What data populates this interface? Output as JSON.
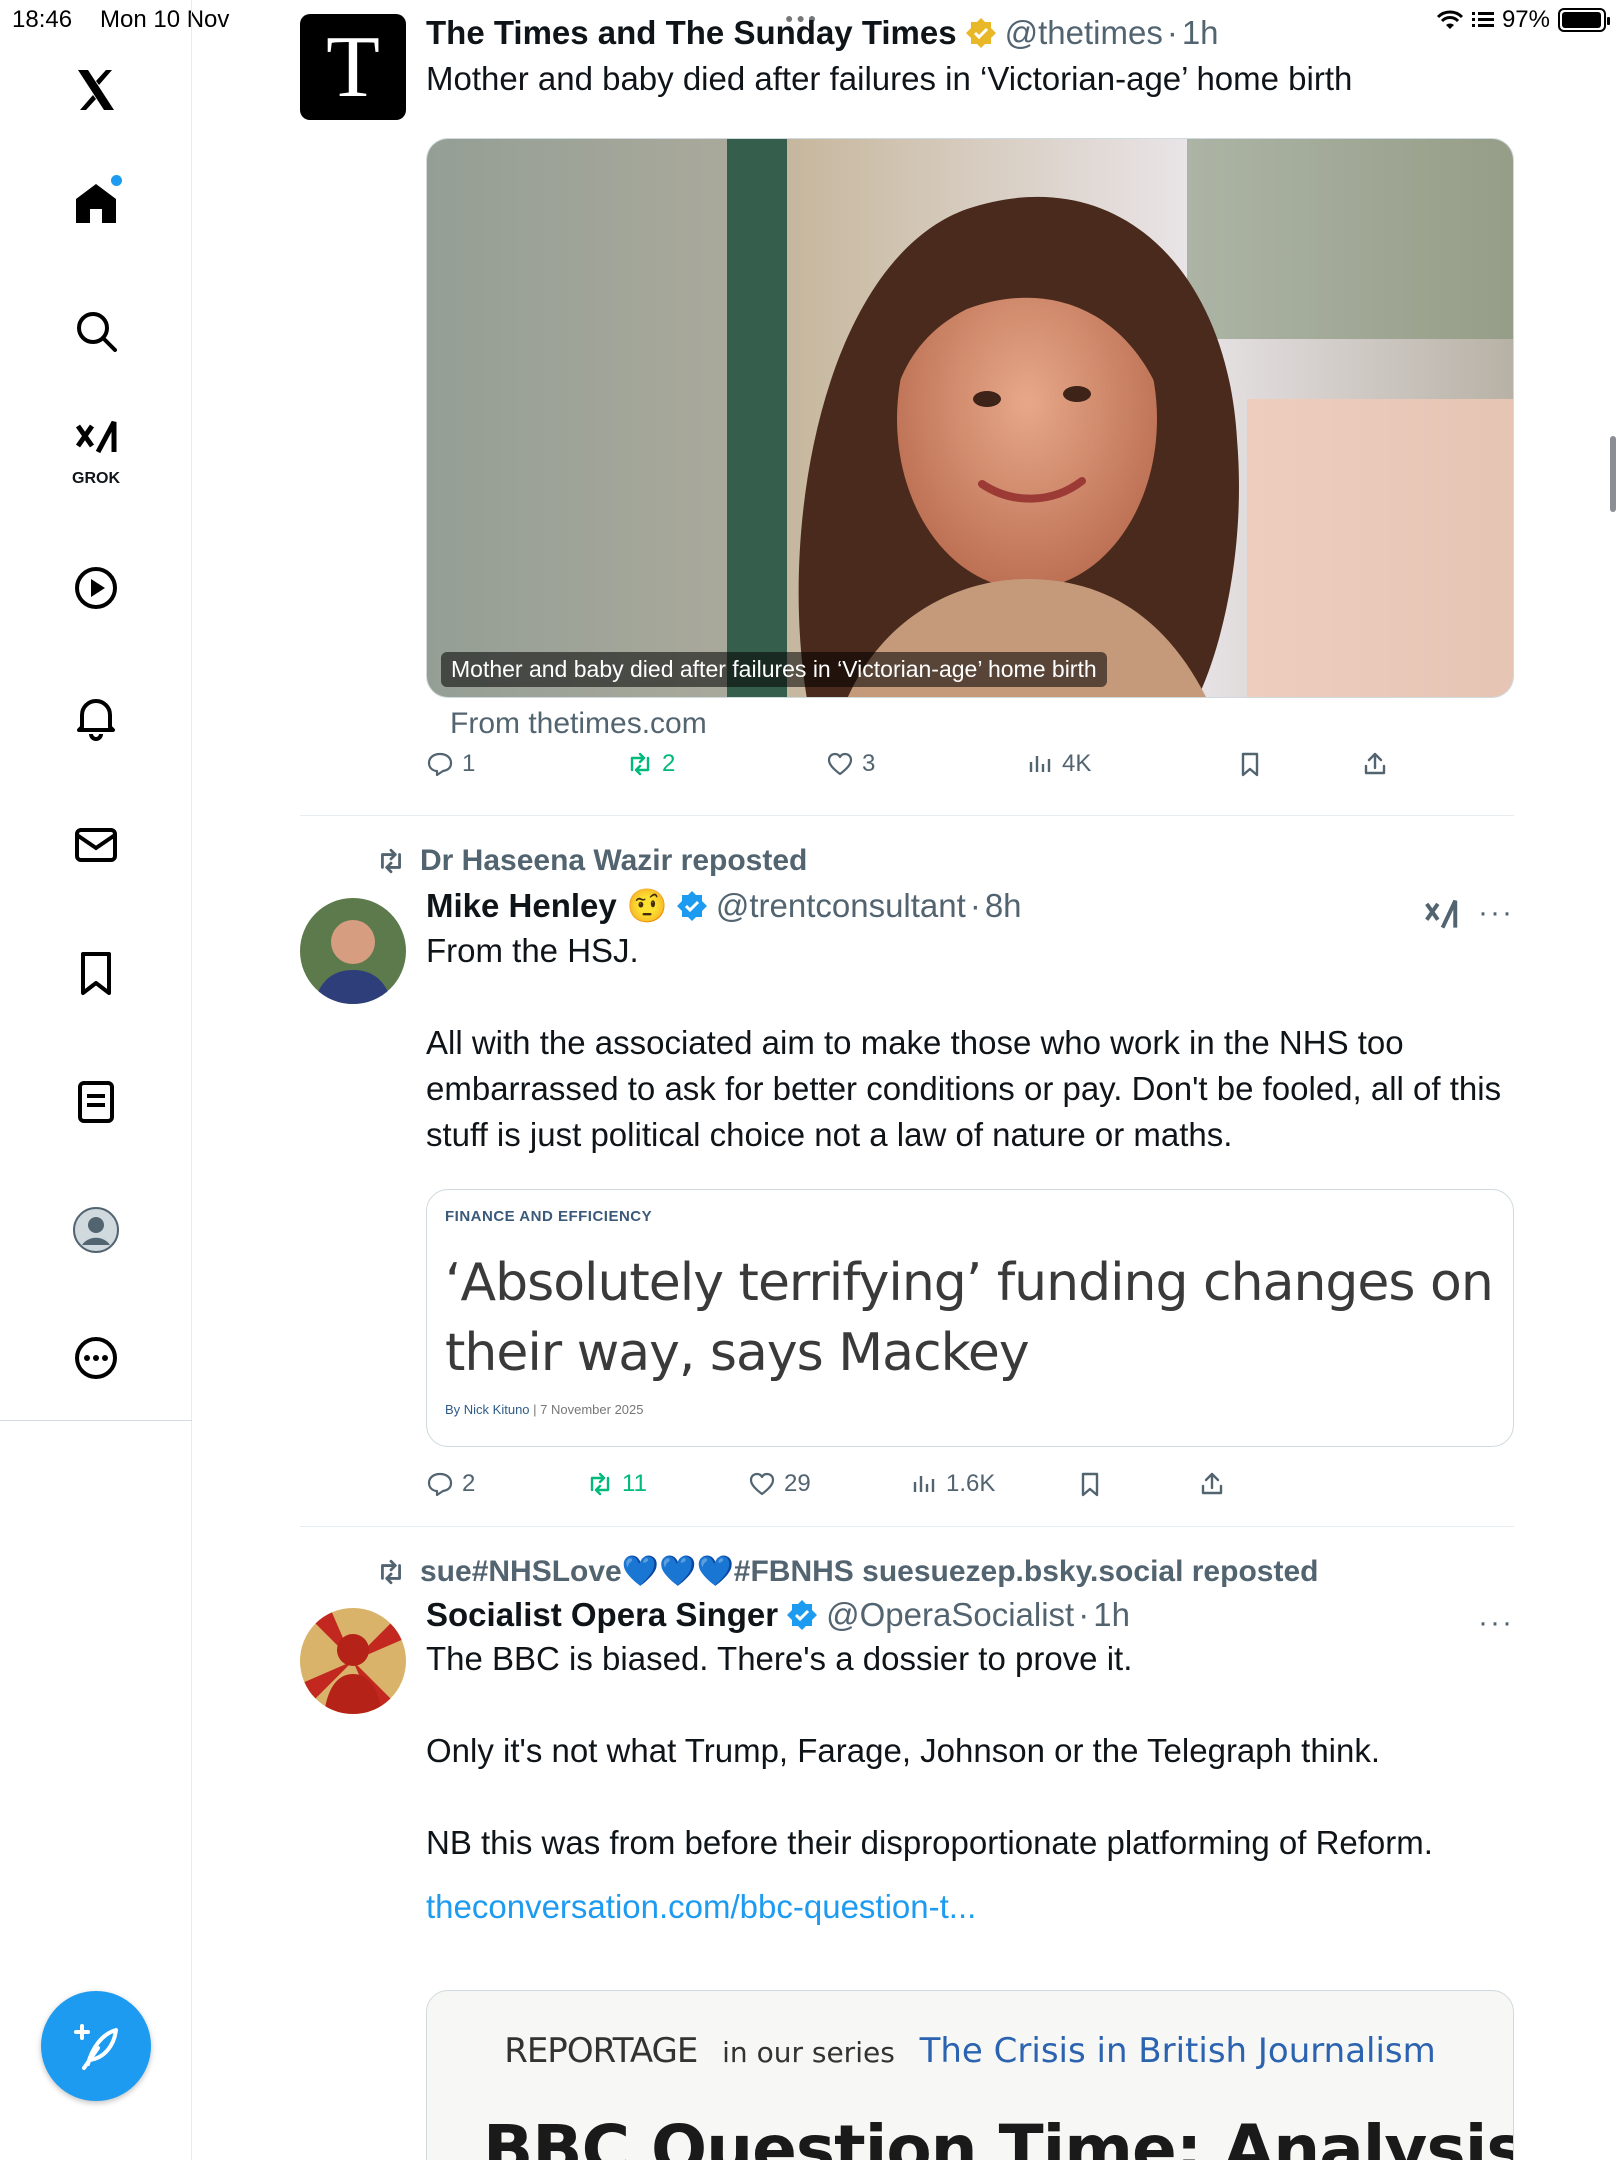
{
  "status_bar": {
    "time": "18:46",
    "date": "Mon 10 Nov",
    "battery": "97%",
    "battery_level": 0.97
  },
  "sidebar": {
    "items": [
      {
        "icon": "x-logo-icon",
        "label": "X"
      },
      {
        "icon": "home-icon",
        "label": "Home"
      },
      {
        "icon": "search-icon",
        "label": "Explore"
      },
      {
        "icon": "grok-icon",
        "label": "GROK"
      },
      {
        "icon": "play-icon",
        "label": "Video"
      },
      {
        "icon": "bell-icon",
        "label": "Notifications"
      },
      {
        "icon": "mail-icon",
        "label": "Messages"
      },
      {
        "icon": "bookmark-icon",
        "label": "Bookmarks"
      },
      {
        "icon": "list-icon",
        "label": "Lists"
      },
      {
        "icon": "profile-icon",
        "label": "Profile"
      },
      {
        "icon": "more-icon",
        "label": "More"
      }
    ],
    "grok_label": "GROK"
  },
  "posts": [
    {
      "avatar_letter": "T",
      "name": "The Times and The Sunday Times",
      "handle": "@thetimes",
      "time": "1h",
      "text": "Mother and baby died after failures in ‘Victorian-age’ home birth",
      "media_caption": "Mother and baby died after failures in ‘Victorian-age’ home birth",
      "source": "From thetimes.com",
      "stats": {
        "replies": "1",
        "reposts": "2",
        "likes": "3",
        "views": "4K"
      }
    },
    {
      "reposted_by": "Dr Haseena Wazir reposted",
      "name": "Mike Henley",
      "emoji": "🤨",
      "handle": "@trentconsultant",
      "time": "8h",
      "text": "From the HSJ.\n\nAll with the associated aim to make those who work in the NHS too embarrassed to ask for better conditions or pay. Don't be fooled, all of this stuff is just political choice not a law of nature or maths.",
      "card": {
        "kicker": "FINANCE AND EFFICIENCY",
        "headline": "‘Absolutely terrifying’ funding changes on their way, says Mackey",
        "byline_prefix": "By Nick Kituno",
        "byline_date": "| 7 November 2025"
      },
      "stats": {
        "replies": "2",
        "reposts": "11",
        "likes": "29",
        "views": "1.6K"
      }
    },
    {
      "reposted_by": "sue#NHSLove💙💙💙#FBNHS suesuezep.bsky.social reposted",
      "name": "Socialist Opera Singer",
      "handle": "@OperaSocialist",
      "time": "1h",
      "text": "The BBC is biased. There's a dossier to prove it.\n\nOnly it's not what Trump, Farage, Johnson or the Telegraph think.\n\nNB this was from before their disproportionate platforming of Reform.",
      "link": "theconversation.com/bbc-question-t...",
      "card": {
        "series_left": "REPORTAGE",
        "series_mid": "in our series",
        "series_right": "The Crisis in British Journalism",
        "big_title": "BBC Question Time: Analysis of"
      }
    }
  ],
  "colors": {
    "accent": "#1d9bf0",
    "repost_green": "#00ba7c",
    "muted": "#536471",
    "gold_badge": "#e8b829"
  }
}
